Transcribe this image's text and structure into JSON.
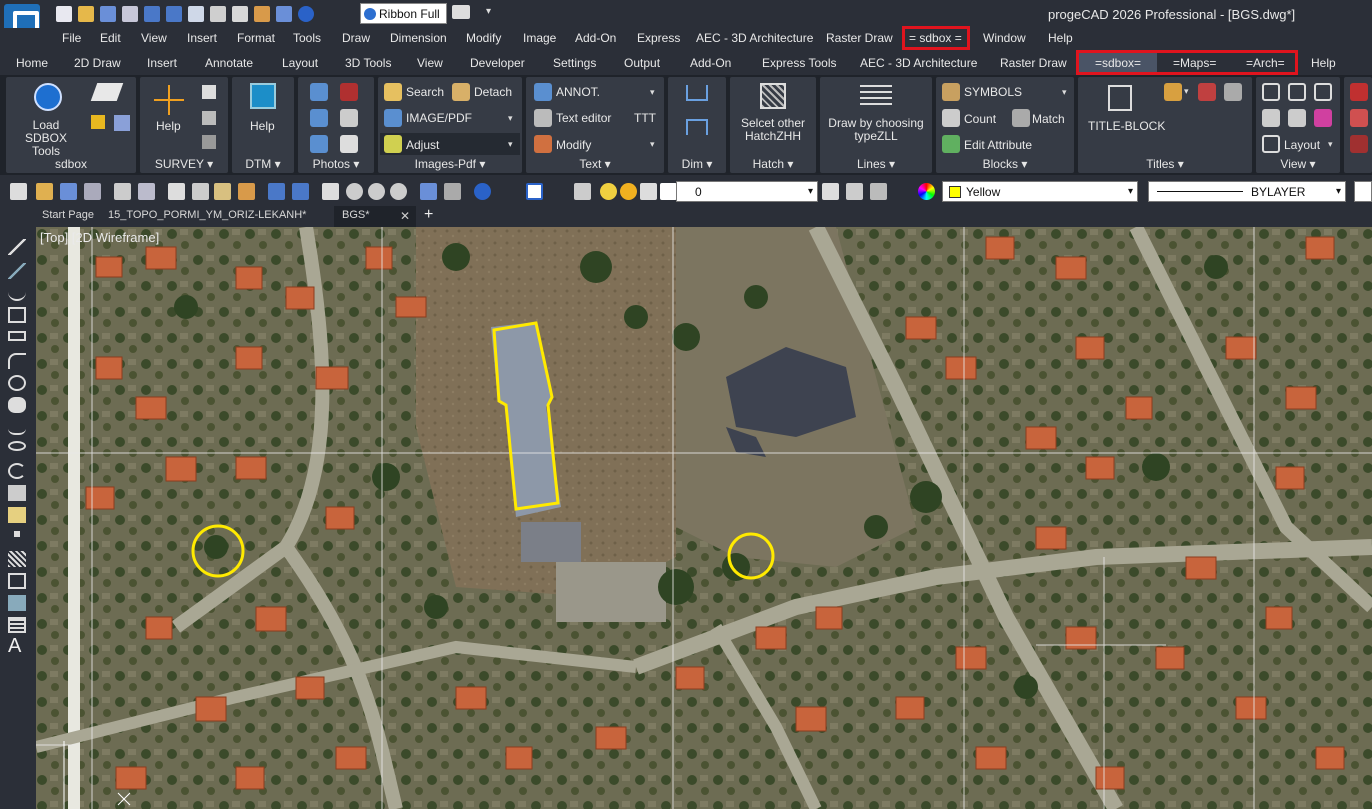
{
  "app": {
    "title": "progeCAD 2026 Professional - [BGS.dwg*]",
    "ribbon_style": "Ribbon Full"
  },
  "menu": [
    "File",
    "Edit",
    "View",
    "Insert",
    "Format",
    "Tools",
    "Draw",
    "Dimension",
    "Modify",
    "Image",
    "Add-On",
    "Express",
    "AEC - 3D Architecture",
    "Raster Draw",
    "= sdbox =",
    "Window",
    "Help"
  ],
  "tabs": [
    "Home",
    "2D Draw",
    "Insert",
    "Annotate",
    "Layout",
    "3D Tools",
    "View",
    "Developer",
    "Settings",
    "Output",
    "Add-On",
    "Express Tools",
    "AEC - 3D Architecture",
    "Raster Draw",
    "=sdbox=",
    "=Maps=",
    "=Arch=",
    "Help"
  ],
  "ribbon": {
    "sdbox": {
      "label": "sdbox",
      "load": "Load SDBOX Tools"
    },
    "survey": {
      "label": "SURVEY",
      "help": "Help"
    },
    "dtm": {
      "label": "DTM",
      "help": "Help"
    },
    "photos": {
      "label": "Photos"
    },
    "images_pdf": {
      "label": "Images-Pdf",
      "search": "Search",
      "detach": "Detach",
      "image_pdf": "IMAGE/PDF",
      "adjust": "Adjust"
    },
    "text": {
      "label": "Text",
      "annot": "ANNOT.",
      "editor": "Text editor",
      "ttt": "TTT",
      "modify": "Modify"
    },
    "dim": {
      "label": "Dim"
    },
    "hatch": {
      "label": "Hatch",
      "select": "Selcet other HatchZHH"
    },
    "lines": {
      "label": "Lines",
      "draw": "Draw by choosing typeZLL"
    },
    "blocks": {
      "label": "Blocks",
      "symbols": "SYMBOLS",
      "count": "Count",
      "match": "Match",
      "edit_attr": "Edit Attribute"
    },
    "titles": {
      "label": "Titles",
      "title_block": "TITLE-BLOCK"
    },
    "view": {
      "label": "View",
      "layout": "Layout"
    }
  },
  "toolbar": {
    "layer": "0",
    "color": "Yellow",
    "linetype": "BYLAYER"
  },
  "doc_tabs": [
    "Start Page",
    "15_TOPO_PORMI_YM_ORIZ-LEKANH*",
    "BGS*"
  ],
  "viewport_label": "[Top] [2D Wireframe]",
  "colors": {
    "accent_red": "#e0141e",
    "highlight_yellow": "#ffea00",
    "ribbon_bg": "#363b45"
  }
}
